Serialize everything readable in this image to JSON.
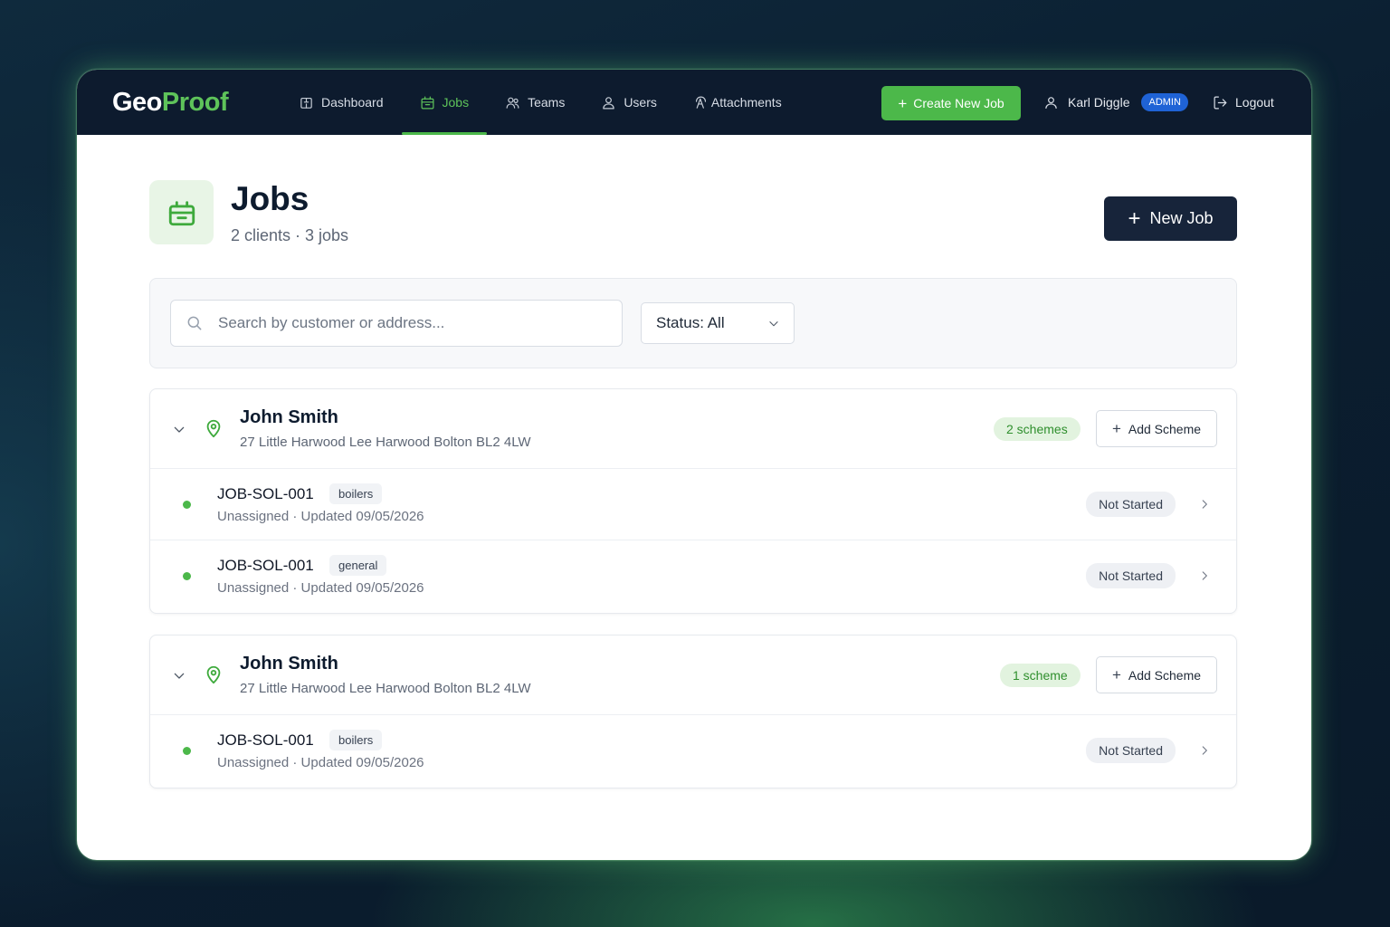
{
  "nav": {
    "logo_part1": "Geo",
    "logo_part2": "Proof",
    "items": [
      {
        "label": "Dashboard",
        "icon": "dashboard-icon"
      },
      {
        "label": "Jobs",
        "icon": "briefcase-icon",
        "active": true
      },
      {
        "label": "Teams",
        "icon": "teams-icon"
      },
      {
        "label": "Users",
        "icon": "user-icon"
      },
      {
        "label": "Attachments",
        "icon": "attachment-icon"
      }
    ],
    "create_label": "Create New Job",
    "user_name": "Karl Diggle",
    "role_badge": "ADMIN",
    "logout_label": "Logout"
  },
  "header": {
    "title": "Jobs",
    "subtitle": "2 clients · 3 jobs",
    "new_job_label": "New Job"
  },
  "filters": {
    "search_placeholder": "Search by customer or address...",
    "status_label": "Status: All"
  },
  "clients": [
    {
      "name": "John Smith",
      "address": "27 Little Harwood Lee Harwood Bolton BL2 4LW",
      "scheme_count": "2 schemes",
      "add_scheme_label": "Add Scheme",
      "jobs": [
        {
          "id": "JOB-SOL-001",
          "tag": "boilers",
          "meta": "Unassigned · Updated 09/05/2026",
          "status": "Not Started"
        },
        {
          "id": "JOB-SOL-001",
          "tag": "general",
          "meta": "Unassigned · Updated 09/05/2026",
          "status": "Not Started"
        }
      ]
    },
    {
      "name": "John Smith",
      "address": "27 Little Harwood Lee Harwood Bolton BL2 4LW",
      "scheme_count": "1 scheme",
      "add_scheme_label": "Add Scheme",
      "jobs": [
        {
          "id": "JOB-SOL-001",
          "tag": "boilers",
          "meta": "Unassigned · Updated 09/05/2026",
          "status": "Not Started"
        }
      ]
    }
  ],
  "colors": {
    "brand_green": "#4cb84a",
    "nav_bg": "#0d1b2e",
    "admin_blue": "#1f63d6"
  }
}
